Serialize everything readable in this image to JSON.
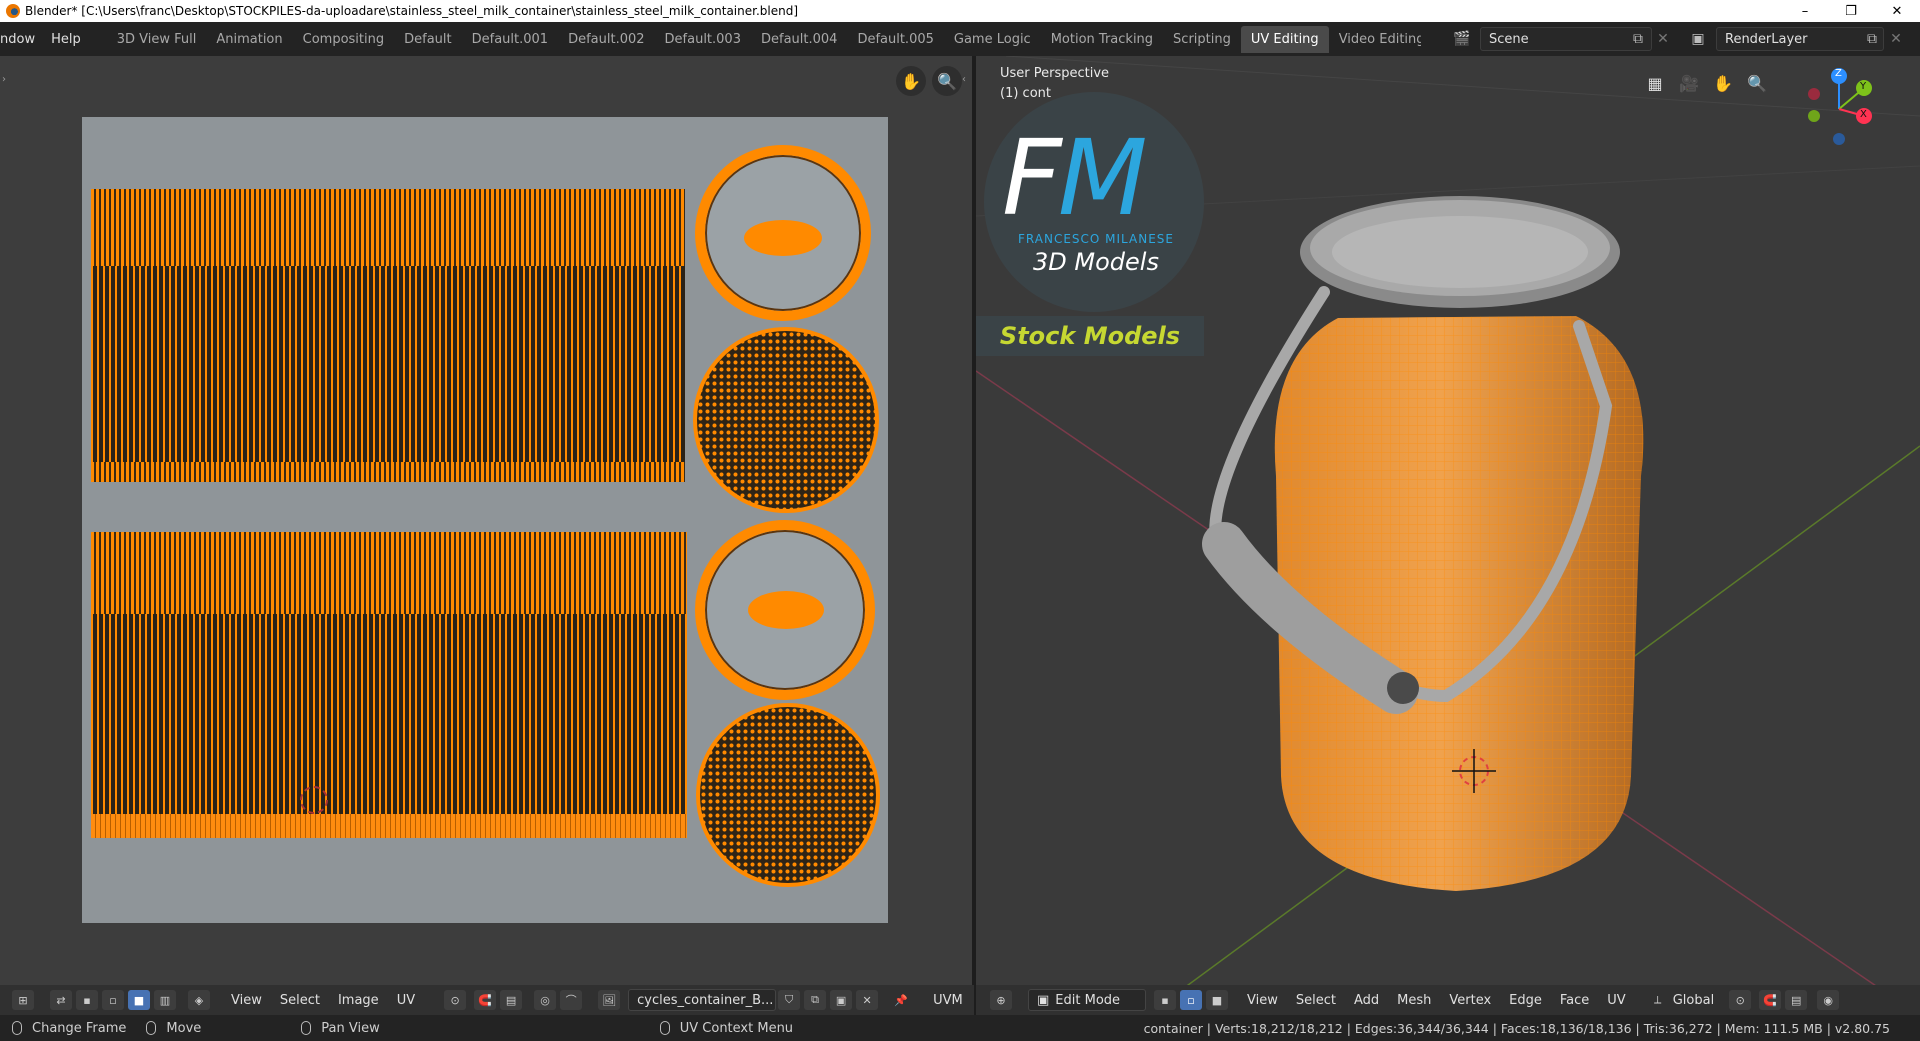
{
  "window": {
    "title": "Blender* [C:\\Users\\franc\\Desktop\\STOCKPILES-da-uploadare\\stainless_steel_milk_container\\stainless_steel_milk_container.blend]",
    "minimize": "–",
    "maximize": "❐",
    "close": "✕"
  },
  "menus": [
    "ndow",
    "Help"
  ],
  "workspaces": [
    "3D View Full",
    "Animation",
    "Compositing",
    "Default",
    "Default.001",
    "Default.002",
    "Default.003",
    "Default.004",
    "Default.005",
    "Game Logic",
    "Motion Tracking",
    "Scripting",
    "UV Editing",
    "Video Editing"
  ],
  "active_workspace": "UV Editing",
  "scene": {
    "name": "Scene",
    "render_layer": "RenderLayer"
  },
  "uv_editor": {
    "menus": [
      "View",
      "Select",
      "Image",
      "UV"
    ],
    "image_name": "cycles_container_B...",
    "uv_map_label": "UVM"
  },
  "viewport": {
    "perspective_label": "User Perspective",
    "object_label": "(1) cont",
    "mode": "Edit Mode",
    "menus": [
      "View",
      "Select",
      "Add",
      "Mesh",
      "Vertex",
      "Edge",
      "Face",
      "UV"
    ],
    "transform_orientation": "Global",
    "gizmo_axes": {
      "z": "Z",
      "y": "Y",
      "x": "X"
    }
  },
  "watermark": {
    "letters_f": "F",
    "letters_m": "M",
    "author": "FRANCESCO MILANESE",
    "subtitle": "3D Models",
    "banner": "Stock Models"
  },
  "statusbar": {
    "items": [
      "Change Frame",
      "Move",
      "Pan View",
      "UV Context Menu"
    ],
    "stats": "container | Verts:18,212/18,212 | Edges:36,344/36,344 | Faces:18,136/18,136 | Tris:36,272 | Mem: 111.5 MB | v2.80.75"
  },
  "colors": {
    "accent": "#4772b3",
    "selection_orange": "#ff8a00",
    "watermark_blue": "#2ca6de",
    "watermark_green": "#c6d832"
  }
}
